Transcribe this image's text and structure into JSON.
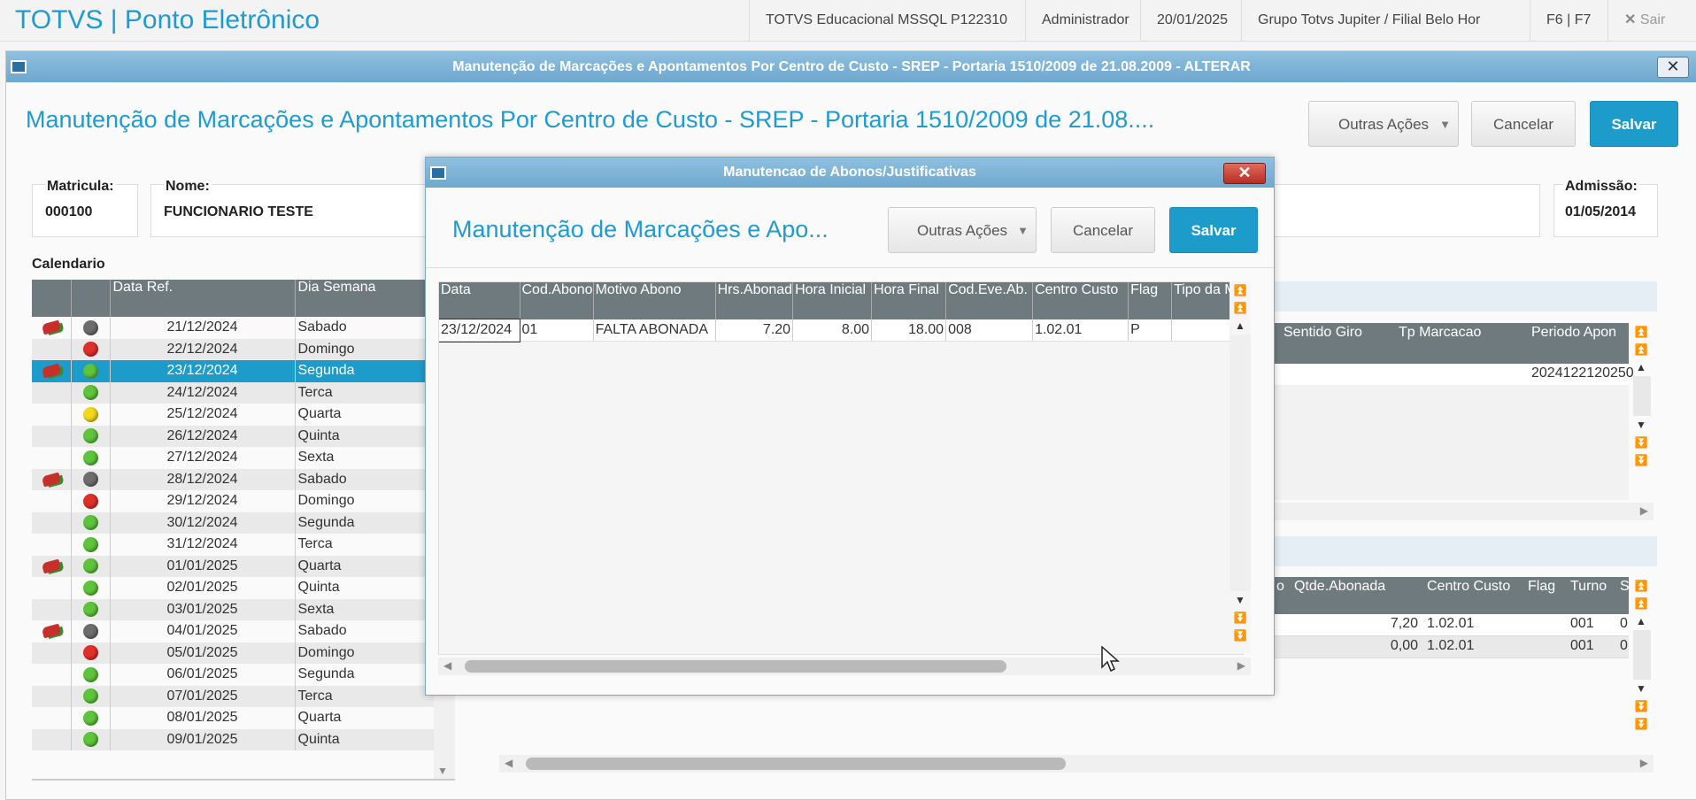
{
  "topbar": {
    "app_title": "TOTVS | Ponto Eletrônico",
    "environment": "TOTVS Educacional MSSQL P122310",
    "user": "Administrador",
    "date": "20/01/2025",
    "company": "Grupo Totvs Jupiter / Filial Belo Hor",
    "shortcut": "F6 | F7",
    "exit_label": "Sair"
  },
  "main_window": {
    "title": "Manutenção de Marcações e Apontamentos Por Centro de Custo - SREP - Portaria 1510/2009 de 21.08.2009 - ALTERAR",
    "header": "Manutenção de Marcações e Apontamentos Por Centro de Custo - SREP - Portaria 1510/2009 de 21.08....",
    "buttons": {
      "other_actions": "Outras Ações",
      "cancel": "Cancelar",
      "save": "Salvar"
    },
    "fields": {
      "matricula_label": "Matricula:",
      "matricula_value": "000100",
      "nome_label": "Nome:",
      "nome_value": "FUNCIONARIO TESTE",
      "admissao_label": "Admissão:",
      "admissao_value": "01/05/2014"
    },
    "calendar": {
      "label": "Calendario",
      "columns": [
        "",
        "",
        "Data Ref.",
        "Dia Semana"
      ],
      "rows": [
        {
          "pin": true,
          "status": "gray",
          "date": "21/12/2024",
          "day": "Sabado"
        },
        {
          "pin": false,
          "status": "red",
          "date": "22/12/2024",
          "day": "Domingo"
        },
        {
          "pin": true,
          "status": "green",
          "date": "23/12/2024",
          "day": "Segunda",
          "selected": true
        },
        {
          "pin": false,
          "status": "green",
          "date": "24/12/2024",
          "day": "Terca"
        },
        {
          "pin": false,
          "status": "yellow",
          "date": "25/12/2024",
          "day": "Quarta"
        },
        {
          "pin": false,
          "status": "green",
          "date": "26/12/2024",
          "day": "Quinta"
        },
        {
          "pin": false,
          "status": "green",
          "date": "27/12/2024",
          "day": "Sexta"
        },
        {
          "pin": true,
          "status": "gray",
          "date": "28/12/2024",
          "day": "Sabado"
        },
        {
          "pin": false,
          "status": "red",
          "date": "29/12/2024",
          "day": "Domingo"
        },
        {
          "pin": false,
          "status": "green",
          "date": "30/12/2024",
          "day": "Segunda"
        },
        {
          "pin": false,
          "status": "green",
          "date": "31/12/2024",
          "day": "Terca"
        },
        {
          "pin": true,
          "status": "green",
          "date": "01/01/2025",
          "day": "Quarta"
        },
        {
          "pin": false,
          "status": "green",
          "date": "02/01/2025",
          "day": "Quinta"
        },
        {
          "pin": false,
          "status": "green",
          "date": "03/01/2025",
          "day": "Sexta"
        },
        {
          "pin": true,
          "status": "gray",
          "date": "04/01/2025",
          "day": "Sabado"
        },
        {
          "pin": false,
          "status": "red",
          "date": "05/01/2025",
          "day": "Domingo"
        },
        {
          "pin": false,
          "status": "green",
          "date": "06/01/2025",
          "day": "Segunda"
        },
        {
          "pin": false,
          "status": "green",
          "date": "07/01/2025",
          "day": "Terca"
        },
        {
          "pin": false,
          "status": "green",
          "date": "08/01/2025",
          "day": "Quarta"
        },
        {
          "pin": false,
          "status": "green",
          "date": "09/01/2025",
          "day": "Quinta"
        }
      ]
    },
    "marcacoes_grid": {
      "columns": [
        "Sentido Giro",
        "Tp Marcacao",
        "Periodo Apon"
      ],
      "row": [
        "",
        "",
        "2024122120250"
      ]
    },
    "abonos_grid": {
      "columns": [
        "o",
        "Qtde.Abonada",
        "Centro Custo",
        "Flag",
        "Turno",
        "S"
      ],
      "rows": [
        [
          "",
          "7,20",
          "1.02.01",
          "",
          "001",
          "0"
        ],
        [
          "",
          "0,00",
          "1.02.01",
          "",
          "001",
          "0"
        ]
      ]
    }
  },
  "dialog": {
    "title": "Manutencao de Abonos/Justificativas",
    "header": "Manutenção de Marcações e Apo...",
    "buttons": {
      "other_actions": "Outras Ações",
      "cancel": "Cancelar",
      "save": "Salvar"
    },
    "grid": {
      "columns": [
        "Data",
        "Cod.Abono",
        "Motivo Abono",
        "Hrs.Abonad",
        "Hora Inicial",
        "Hora Final",
        "Cod.Eve.Ab.",
        "Centro Custo",
        "Flag",
        "Tipo da M"
      ],
      "rows": [
        [
          "23/12/2024",
          "01",
          "FALTA ABONADA",
          "7.20",
          "8.00",
          "18.00",
          "008",
          "1.02.01",
          "P",
          ""
        ]
      ]
    }
  },
  "colors": {
    "accent": "#1d9ccc",
    "header_grid": "#6f7a7f",
    "titlebar": "#7fb4d8"
  },
  "icons": {
    "close": "close-icon",
    "window": "window-icon",
    "exit": "x-icon"
  }
}
